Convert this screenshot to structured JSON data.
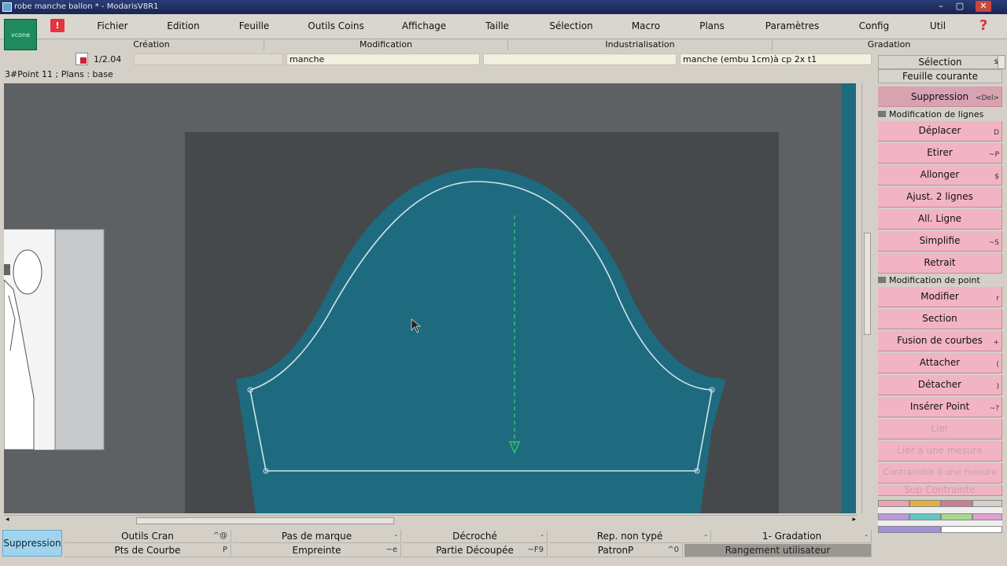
{
  "window": {
    "title": "robe manche ballon * - ModarisV8R1"
  },
  "menu": {
    "logo_text": "vcone",
    "items": [
      "Fichier",
      "Edition",
      "Feuille",
      "Outils Coins",
      "Affichage",
      "Taille",
      "Sélection",
      "Macro",
      "Plans",
      "Paramètres",
      "Config",
      "Util"
    ],
    "help": "?"
  },
  "sections": [
    "Création",
    "Modification",
    "Industrialisation",
    "Gradation"
  ],
  "toolbar": {
    "scale": "1/2.04",
    "field1": "manche",
    "field2": "",
    "field3": "manche (embu 1cm)à cp 2x t1"
  },
  "status": {
    "text": "3#Point 11 ;     Plans : base"
  },
  "right_panel": {
    "selection_label": "Sélection",
    "selection_key": "s",
    "current_sheet": "Feuille courante",
    "suppression": {
      "label": "Suppression",
      "shortcut": "<Del>"
    },
    "group_lines": "Modification de lignes",
    "line_tools": [
      {
        "label": "Déplacer",
        "shortcut": "D"
      },
      {
        "label": "Etirer",
        "shortcut": "~P"
      },
      {
        "label": "Allonger",
        "shortcut": "$"
      },
      {
        "label": "Ajust. 2 lignes",
        "shortcut": ""
      },
      {
        "label": "All. Ligne",
        "shortcut": ""
      },
      {
        "label": "Simplifie",
        "shortcut": "~S"
      },
      {
        "label": "Retrait",
        "shortcut": ""
      }
    ],
    "group_points": "Modification de point",
    "point_tools": [
      {
        "label": "Modifier",
        "shortcut": "r"
      },
      {
        "label": "Section",
        "shortcut": ""
      },
      {
        "label": "Fusion de courbes",
        "shortcut": "+"
      },
      {
        "label": "Attacher",
        "shortcut": "("
      },
      {
        "label": "Détacher",
        "shortcut": ")"
      },
      {
        "label": "Insérer Point",
        "shortcut": "~?"
      }
    ],
    "dim_tools": [
      {
        "label": "Lier",
        "shortcut": ""
      },
      {
        "label": "Lier à une mesure",
        "shortcut": ""
      },
      {
        "label": "Contraindre à une mesure",
        "shortcut": ""
      },
      {
        "label": "Sup Contrainte",
        "shortcut": ""
      }
    ]
  },
  "bottom_bar": {
    "suppress_button": "Suppression",
    "row1": [
      {
        "label": "Outils Cran",
        "key": "^@"
      },
      {
        "label": "Pas de marque",
        "key": "-"
      },
      {
        "label": "Décroché",
        "key": "-"
      },
      {
        "label": "Rep. non typé",
        "key": "-"
      },
      {
        "label": "1- Gradation",
        "key": "-"
      }
    ],
    "row2": [
      {
        "label": "Pts de Courbe",
        "key": "P"
      },
      {
        "label": "Empreinte",
        "key": "~e"
      },
      {
        "label": "Partie Découpée",
        "key": "~F9"
      },
      {
        "label": "PatronP",
        "key": "^0"
      },
      {
        "label": "Rangement utilisateur",
        "key": ""
      }
    ]
  },
  "colors": {
    "canvas_bg": "#5d6164",
    "sheet_bg": "#45494b",
    "piece_fill": "#1e6b7f",
    "seam_line": "#cfe3ea",
    "grain_line": "#35c26a",
    "accent_pink": "#f2b4c4",
    "suppress_blue": "#9fd3ee"
  }
}
